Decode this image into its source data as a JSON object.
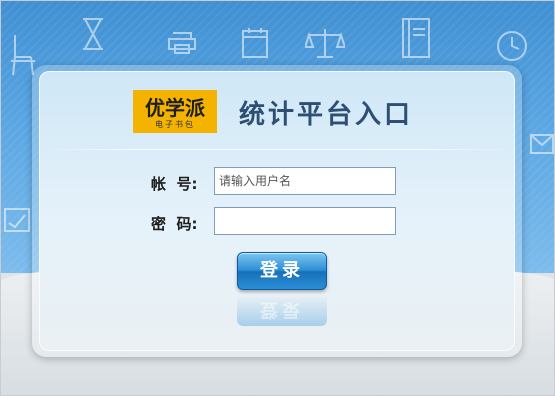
{
  "brand": {
    "logo_text": "优学派",
    "logo_subtext": "电子书包"
  },
  "header": {
    "title": "统计平台入口"
  },
  "form": {
    "account_label": "帐  号:",
    "account_placeholder": "请输入用户名",
    "account_value": "",
    "password_label": "密  码:",
    "password_value": "",
    "login_button": "登录"
  },
  "colors": {
    "logo_background": "#f4b300",
    "title_text": "#2e4f73",
    "button_blue": "#2c8ed6",
    "sky_blue": "#5aa6e3"
  }
}
